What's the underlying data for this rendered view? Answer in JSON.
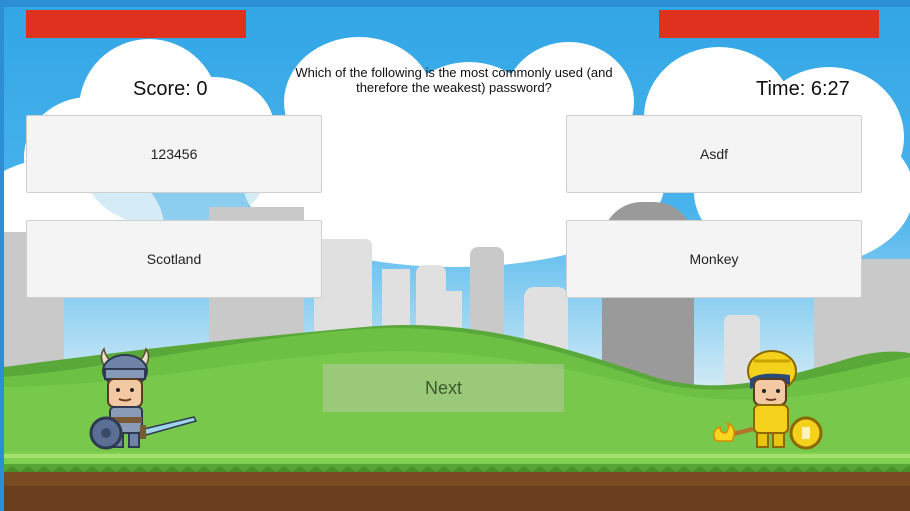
{
  "hud": {
    "score": "Score: 0",
    "time": "Time: 6:27",
    "health_color": "#e0301e"
  },
  "question": "Which of the following is the most commonly used (and therefore the weakest) password?",
  "answers": [
    "123456",
    "Asdf",
    "Scotland",
    "Monkey"
  ],
  "next_label": "Next",
  "characters": {
    "player": "viking-knight",
    "enemy": "golden-knight"
  }
}
